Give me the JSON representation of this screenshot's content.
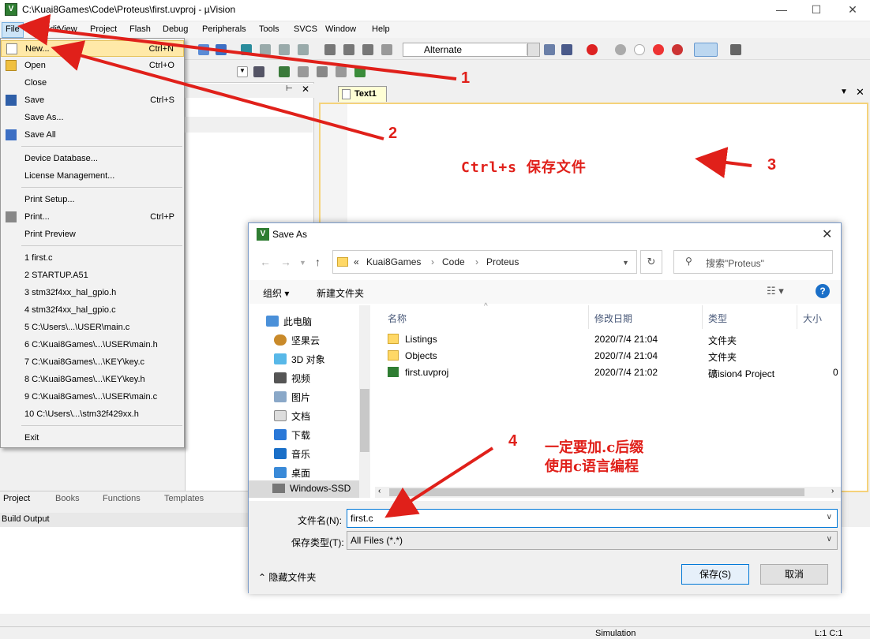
{
  "window": {
    "title": "C:\\Kuai8Games\\Code\\Proteus\\first.uvproj - µVision",
    "logo": "V",
    "minimize": "—",
    "maximize": "☐",
    "close": "✕"
  },
  "menubar": [
    "File",
    "Edit",
    "View",
    "Project",
    "Flash",
    "Debug",
    "Peripherals",
    "Tools",
    "SVCS",
    "Window",
    "Help"
  ],
  "toolbar": {
    "target": "Alternate"
  },
  "file_menu": [
    {
      "label": "New...",
      "shortcut": "Ctrl+N",
      "icon": "new-file-icon"
    },
    {
      "label": "Open",
      "shortcut": "Ctrl+O",
      "icon": "open-folder-icon"
    },
    {
      "label": "Close",
      "shortcut": ""
    },
    {
      "label": "Save",
      "shortcut": "Ctrl+S",
      "icon": "save-icon"
    },
    {
      "label": "Save As...",
      "shortcut": ""
    },
    {
      "label": "Save All",
      "shortcut": "",
      "icon": "save-all-icon"
    },
    {
      "label": "Device Database...",
      "shortcut": ""
    },
    {
      "label": "License Management...",
      "shortcut": ""
    },
    {
      "label": "Print Setup...",
      "shortcut": ""
    },
    {
      "label": "Print...",
      "shortcut": "Ctrl+P",
      "icon": "printer-icon"
    },
    {
      "label": "Print Preview",
      "shortcut": ""
    },
    {
      "label": "1 first.c",
      "shortcut": ""
    },
    {
      "label": "2 STARTUP.A51",
      "shortcut": ""
    },
    {
      "label": "3 stm32f4xx_hal_gpio.h",
      "shortcut": ""
    },
    {
      "label": "4 stm32f4xx_hal_gpio.c",
      "shortcut": ""
    },
    {
      "label": "5 C:\\Users\\...\\USER\\main.c",
      "shortcut": ""
    },
    {
      "label": "6 C:\\Kuai8Games\\...\\USER\\main.h",
      "shortcut": ""
    },
    {
      "label": "7 C:\\Kuai8Games\\...\\KEY\\key.c",
      "shortcut": ""
    },
    {
      "label": "8 C:\\Kuai8Games\\...\\KEY\\key.h",
      "shortcut": ""
    },
    {
      "label": "9 C:\\Kuai8Games\\...\\USER\\main.c",
      "shortcut": ""
    },
    {
      "label": "10 C:\\Users\\...\\stm32f429xx.h",
      "shortcut": ""
    },
    {
      "label": "Exit",
      "shortcut": ""
    }
  ],
  "project_tabs": [
    "Project",
    "Books",
    "Functions",
    "Templates"
  ],
  "build_output": "Build Output",
  "editor": {
    "tab": "Text1",
    "content": "Ctrl+s 保存文件"
  },
  "annotations": {
    "a1": "1",
    "a2": "2",
    "a3": "3",
    "a4": "4",
    "note_line1": "一定要加.c后缀",
    "note_line2": "使用c语言编程"
  },
  "status": {
    "mode": "Simulation",
    "position": "L:1 C:1"
  },
  "dialog": {
    "title": "Save As",
    "breadcrumb": [
      "«",
      "Kuai8Games",
      "Code",
      "Proteus"
    ],
    "search_placeholder": "搜索\"Proteus\"",
    "organize": "组织 ▾",
    "new_folder": "新建文件夹",
    "tree": [
      "此电脑",
      "坚果云",
      "3D 对象",
      "视频",
      "图片",
      "文档",
      "下载",
      "音乐",
      "桌面",
      "Windows-SSD"
    ],
    "columns": [
      "名称",
      "修改日期",
      "类型",
      "大小"
    ],
    "files": [
      {
        "name": "Listings",
        "date": "2020/7/4 21:04",
        "type": "文件夹",
        "size": ""
      },
      {
        "name": "Objects",
        "date": "2020/7/4 21:04",
        "type": "文件夹",
        "size": ""
      },
      {
        "name": "first.uvproj",
        "date": "2020/7/4 21:02",
        "type": "礦ision4 Project",
        "size": "0"
      }
    ],
    "filename_label": "文件名(N):",
    "filename_value": "first.c",
    "filetype_label": "保存类型(T):",
    "filetype_value": "All Files (*.*)",
    "hide_folders": "隐藏文件夹",
    "save": "保存(S)",
    "cancel": "取消"
  },
  "colors": {
    "annotation": "#e0201a",
    "highlight": "#ffe9a8",
    "accent": "#0078d7"
  }
}
